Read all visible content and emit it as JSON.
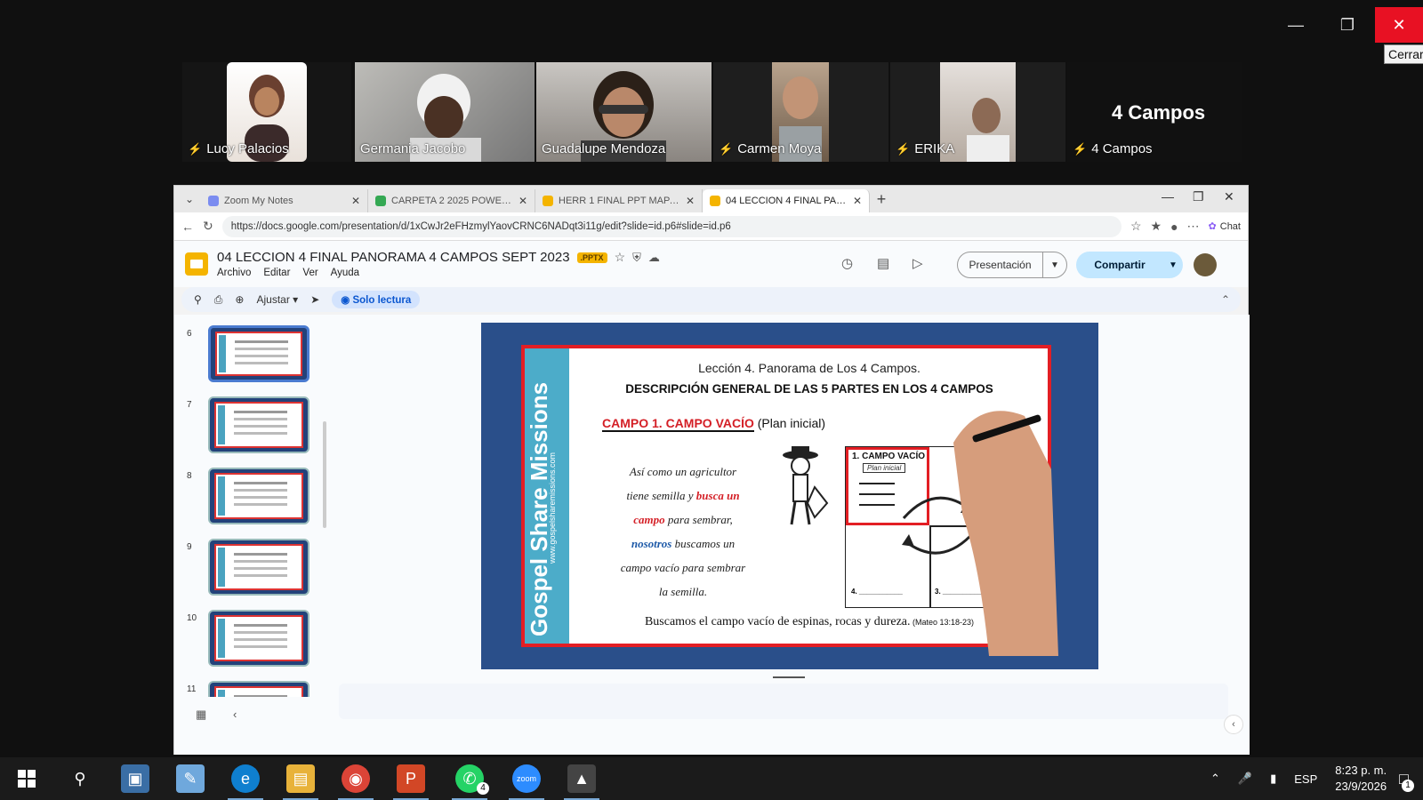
{
  "zoom": {
    "close_tooltip": "Cerrar",
    "room_label": "4 Campos",
    "participants": [
      {
        "name": "Lucy Palacios",
        "muted": true
      },
      {
        "name": "Germania Jacobo",
        "muted": false,
        "active": true
      },
      {
        "name": "Guadalupe Mendoza",
        "muted": false
      },
      {
        "name": "Carmen Moya",
        "muted": true
      },
      {
        "name": "ERIKA",
        "muted": true
      },
      {
        "name": "4 Campos",
        "muted": true
      }
    ]
  },
  "browser": {
    "tabs": [
      {
        "label": "Zoom My Notes",
        "color": "#7b8cf0"
      },
      {
        "label": "CARPETA 2 2025 POWERPOINTS -",
        "color": "#34a853"
      },
      {
        "label": "HERR 1 FINAL PPT MAPA RELACIO",
        "color": "#f4b400"
      },
      {
        "label": "04 LECCION 4 FINAL PANORAMA",
        "color": "#f4b400"
      }
    ],
    "url": "https://docs.google.com/presentation/d/1xCwJr2eFHzmylYaovCRNC6NADqt3i11g/edit?slide=id.p6#slide=id.p6",
    "chat_label": "Chat"
  },
  "slides_app": {
    "title": "04 LECCION 4 FINAL PANORAMA 4 CAMPOS SEPT 2023",
    "badge": ".PPTX",
    "menu": [
      "Archivo",
      "Editar",
      "Ver",
      "Ayuda"
    ],
    "present_label": "Presentación",
    "share_label": "Compartir",
    "zoom_label": "Ajustar",
    "readonly_label": "Solo lectura",
    "thumb_numbers": [
      "6",
      "7",
      "8",
      "9",
      "10",
      "11"
    ],
    "selected_slide": "6"
  },
  "slide": {
    "brand": "Gospel Share Missions",
    "brand_url": "www.gospelsharemissions.com",
    "title": "Lección 4. Panorama de Los 4 Campos.",
    "subtitle": "DESCRIPCIÓN GENERAL DE LAS 5 PARTES EN LOS 4 CAMPOS",
    "campo_heading": "CAMPO 1. CAMPO VACÍO",
    "campo_heading_plain": " (Plan inicial)",
    "body": {
      "p1": "Así como un agricultor",
      "p2": "tiene semilla y ",
      "p2_red": "busca un",
      "p3_red": "campo",
      "p3": " para sembrar,",
      "p4_blue": "nosotros",
      "p4": " buscamos un",
      "p5": "campo vacío para sembrar",
      "p6": "la semilla."
    },
    "diagram": {
      "label1": "1. CAMPO VACÍO",
      "sub1": "Plan inicial",
      "label4": "4. ___________",
      "label3": "3. ___________"
    },
    "footer": "Buscamos el campo vacío de espinas, rocas y dureza.",
    "footer_ref": " (Mateo 13:18-23)"
  },
  "taskbar": {
    "lang": "ESP",
    "time": "8:23 p. m.",
    "date": "23/9/2026",
    "whatsapp_badge": "4",
    "notif_count": "1"
  }
}
